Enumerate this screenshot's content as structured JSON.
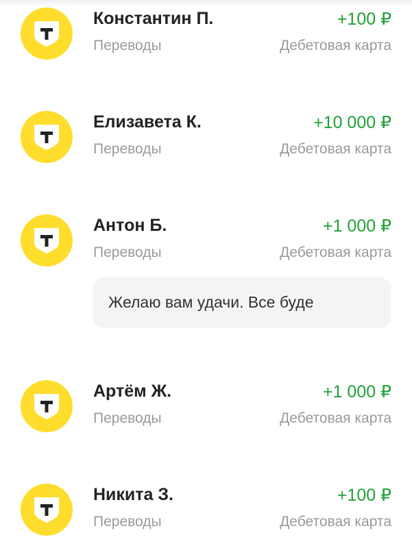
{
  "brand": {
    "accent": "#ffdd2d",
    "positive": "#21a038",
    "muted": "#9a9a9a"
  },
  "transactions": [
    {
      "name": "Константин П.",
      "category": "Переводы",
      "amount": "+100 ₽",
      "account": "Дебетовая карта",
      "icon": "tbank-logo-icon"
    },
    {
      "name": "Елизавета К.",
      "category": "Переводы",
      "amount": "+10 000 ₽",
      "account": "Дебетовая карта",
      "icon": "tbank-logo-icon"
    },
    {
      "name": "Антон Б.",
      "category": "Переводы",
      "amount": "+1 000 ₽",
      "account": "Дебетовая карта",
      "icon": "tbank-logo-icon",
      "message": "Желаю вам удачи. Все буде"
    },
    {
      "name": "Артём Ж.",
      "category": "Переводы",
      "amount": "+1 000 ₽",
      "account": "Дебетовая карта",
      "icon": "tbank-logo-icon"
    },
    {
      "name": "Никита З.",
      "category": "Переводы",
      "amount": "+100 ₽",
      "account": "Дебетовая карта",
      "icon": "tbank-logo-icon"
    }
  ]
}
